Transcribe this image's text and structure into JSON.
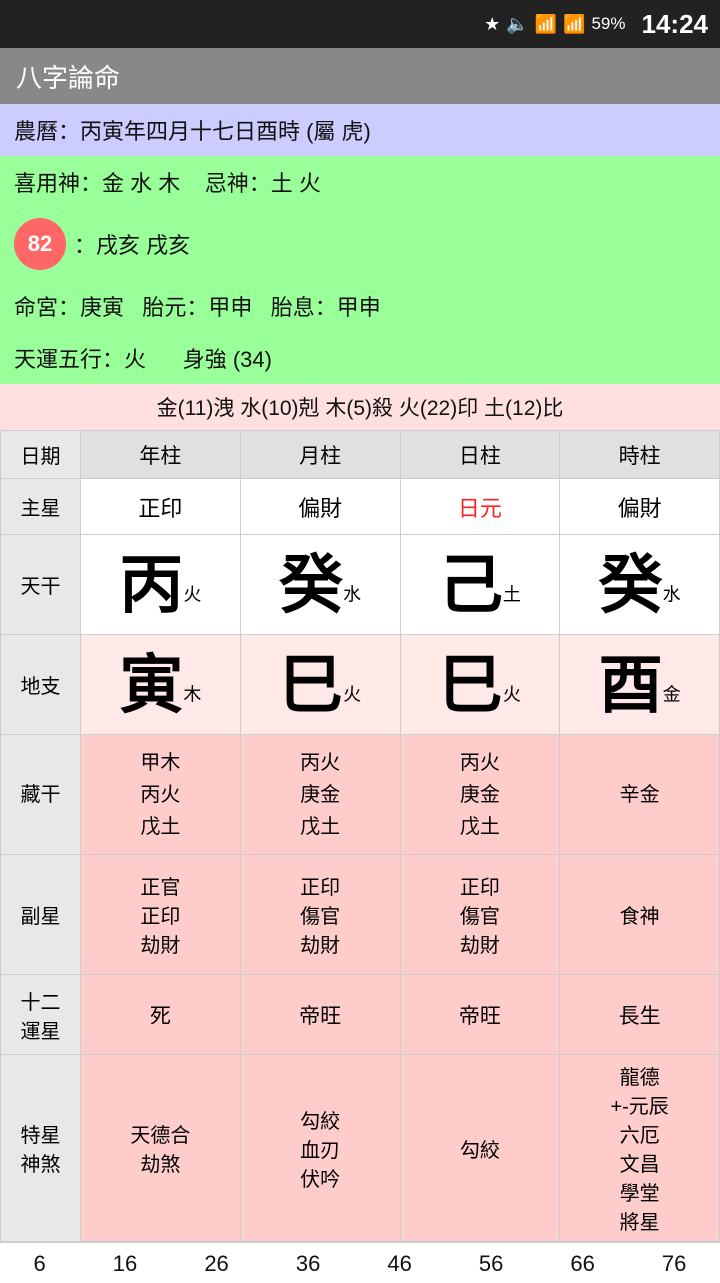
{
  "statusBar": {
    "battery": "59%",
    "time": "14:24"
  },
  "titleBar": {
    "title": "八字論命"
  },
  "infoRows": {
    "row1": "農曆：丙寅年四月十七日酉時 (屬 虎)",
    "row2_label": "喜用神：",
    "row2_value": "金 水 木",
    "row2_label2": "忌神：",
    "row2_value2": "土 火",
    "row3_badge": "82",
    "row3_text": "：戌亥 戌亥",
    "row4_1": "命宮：庚寅",
    "row4_2": "胎元：甲申",
    "row4_3": "胎息：甲申",
    "row5_1": "天運五行：火",
    "row5_2": "身強 (34)",
    "row6": "金(11)洩  水(10)剋  木(5)殺  火(22)印  土(12)比"
  },
  "tableHeaders": [
    "日期",
    "年柱",
    "月柱",
    "日柱",
    "時柱"
  ],
  "zhuxingRow": {
    "label": "主星",
    "cells": [
      "正印",
      "偏財",
      "日元",
      "偏財"
    ],
    "redIndex": 2
  },
  "tiangan": {
    "label": "天干",
    "cells": [
      {
        "big": "丙",
        "small": "火"
      },
      {
        "big": "癸",
        "small": "水"
      },
      {
        "big": "己",
        "small": "土"
      },
      {
        "big": "癸",
        "small": "水"
      }
    ]
  },
  "dizhi": {
    "label": "地支",
    "cells": [
      {
        "big": "寅",
        "small": "木"
      },
      {
        "big": "巳",
        "small": "火"
      },
      {
        "big": "巳",
        "small": "火"
      },
      {
        "big": "酉",
        "small": "金"
      }
    ]
  },
  "zanggan": {
    "label": "藏干",
    "cells": [
      [
        "甲木",
        "丙火",
        "戊土"
      ],
      [
        "丙火",
        "庚金",
        "戊土"
      ],
      [
        "丙火",
        "庚金",
        "戊土"
      ],
      [
        "辛金"
      ]
    ]
  },
  "fuxing": {
    "label": "副星",
    "cells": [
      [
        "正官",
        "正印",
        "劫財"
      ],
      [
        "正印",
        "傷官",
        "劫財"
      ],
      [
        "正印",
        "傷官",
        "劫財"
      ],
      [
        "食神"
      ]
    ]
  },
  "yunxing": {
    "label": "十二\n運星",
    "cells": [
      "死",
      "帝旺",
      "帝旺",
      "長生"
    ]
  },
  "texing": {
    "label": "特星\n神煞",
    "cells": [
      [
        "天德合",
        "劫煞"
      ],
      [
        "勾絞",
        "血刃",
        "伏吟"
      ],
      [
        "勾絞"
      ],
      [
        "龍德",
        "+-元辰",
        "六厄",
        "文昌",
        "學堂",
        "將星"
      ]
    ]
  },
  "bottomNumbers": [
    "6",
    "16",
    "26",
    "36",
    "46",
    "56",
    "66",
    "76"
  ]
}
